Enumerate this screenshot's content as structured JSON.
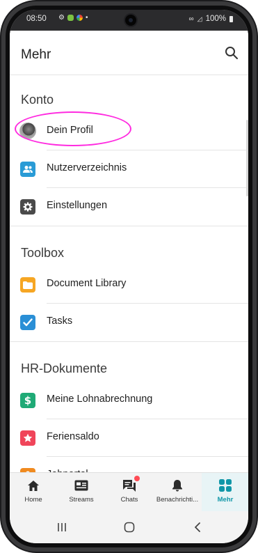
{
  "status_bar": {
    "time": "08:50",
    "battery": "100%"
  },
  "header": {
    "title": "Mehr",
    "search_icon": "search-icon"
  },
  "sections": [
    {
      "title": "Konto",
      "items": [
        {
          "label": "Dein Profil",
          "icon": "avatar"
        },
        {
          "label": "Nutzerverzeichnis",
          "icon": "users-icon",
          "color": "#2a9bd6"
        },
        {
          "label": "Einstellungen",
          "icon": "gear-icon",
          "color": "#4a4a4a"
        }
      ]
    },
    {
      "title": "Toolbox",
      "items": [
        {
          "label": "Document Library",
          "icon": "folder-icon",
          "color": "#f6a623"
        },
        {
          "label": "Tasks",
          "icon": "checkbox-icon",
          "color": "#2a8fd6"
        }
      ]
    },
    {
      "title": "HR-Dokumente",
      "items": [
        {
          "label": "Meine Lohnabrechnung",
          "icon": "dollar-icon",
          "color": "#1faa76"
        },
        {
          "label": "Feriensaldo",
          "icon": "star-icon",
          "color": "#f0455a"
        },
        {
          "label": "Jobportal",
          "icon": "person-icon",
          "color": "#f08a1f"
        }
      ]
    }
  ],
  "bottom_nav": [
    {
      "label": "Home",
      "icon": "home-icon"
    },
    {
      "label": "Streams",
      "icon": "streams-icon"
    },
    {
      "label": "Chats",
      "icon": "chat-icon"
    },
    {
      "label": "Benachrichti...",
      "icon": "bell-icon"
    },
    {
      "label": "Mehr",
      "icon": "grid-icon",
      "active": true
    }
  ],
  "accent_color": "#1097a8"
}
